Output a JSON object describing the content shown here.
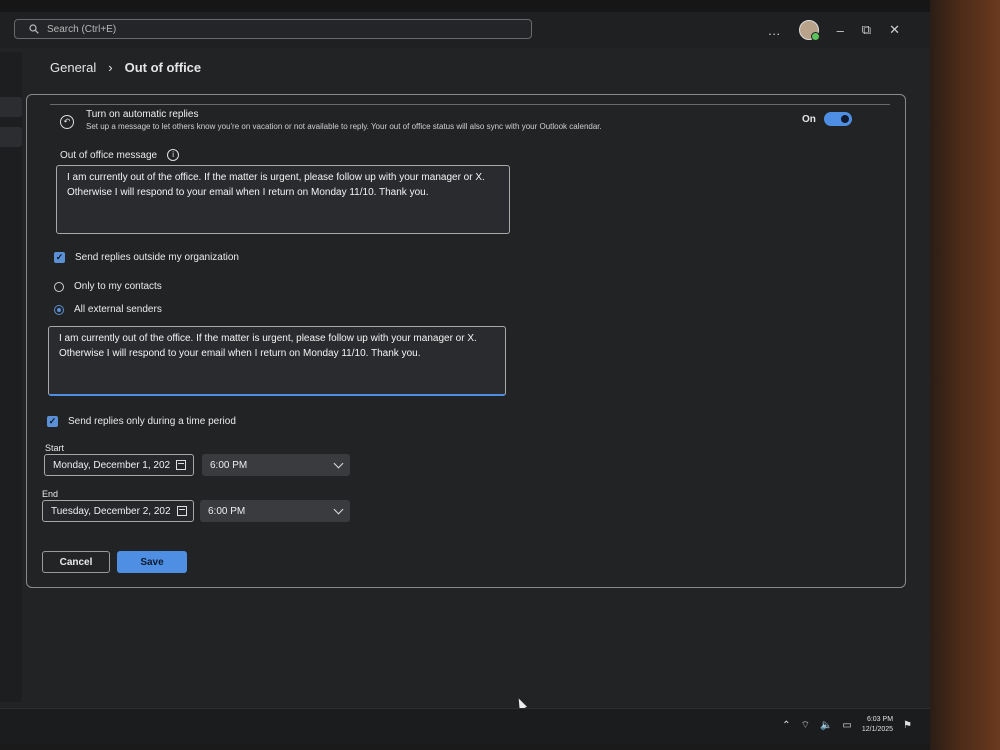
{
  "search": {
    "placeholder": "Search (Ctrl+E)"
  },
  "topbar": {
    "more_icon": "…",
    "minimize_icon": "–",
    "restore_icon": "⧉",
    "close_icon": "✕"
  },
  "breadcrumb": {
    "parent": "General",
    "separator": "›",
    "current": "Out of office"
  },
  "auto_replies": {
    "title": "Turn on automatic replies",
    "description": "Set up a message to let others know you're on vacation or not available to reply. Your out of office status will also sync with your Outlook calendar.",
    "toggle_label": "On",
    "enabled": true
  },
  "internal_message": {
    "label": "Out of office message",
    "text": "I am currently out of the office. If the matter is urgent, please follow up with your manager or X.\nOtherwise I will respond to your email when I return on Monday 11/10. Thank you."
  },
  "outside_org": {
    "label": "Send replies outside my organization",
    "checked": true,
    "options": [
      {
        "label": "Only to my contacts",
        "selected": false
      },
      {
        "label": "All external senders",
        "selected": true
      }
    ],
    "text": "I am currently out of the office. If the matter is urgent, please follow up with your manager or X.\nOtherwise I will respond to your email when I return on Monday 11/10. Thank you."
  },
  "time_period": {
    "label": "Send replies only during a time period",
    "checked": true,
    "start_label": "Start",
    "start_date": "Monday, December 1, 202",
    "start_time": "6:00 PM",
    "end_label": "End",
    "end_date": "Tuesday, December 2, 202",
    "end_time": "6:00 PM"
  },
  "buttons": {
    "cancel": "Cancel",
    "save": "Save"
  },
  "taskbar": {
    "time": "6:03 PM",
    "date": "12/1/2025"
  },
  "colors": {
    "accent": "#4f8fe3",
    "background": "#222325"
  }
}
